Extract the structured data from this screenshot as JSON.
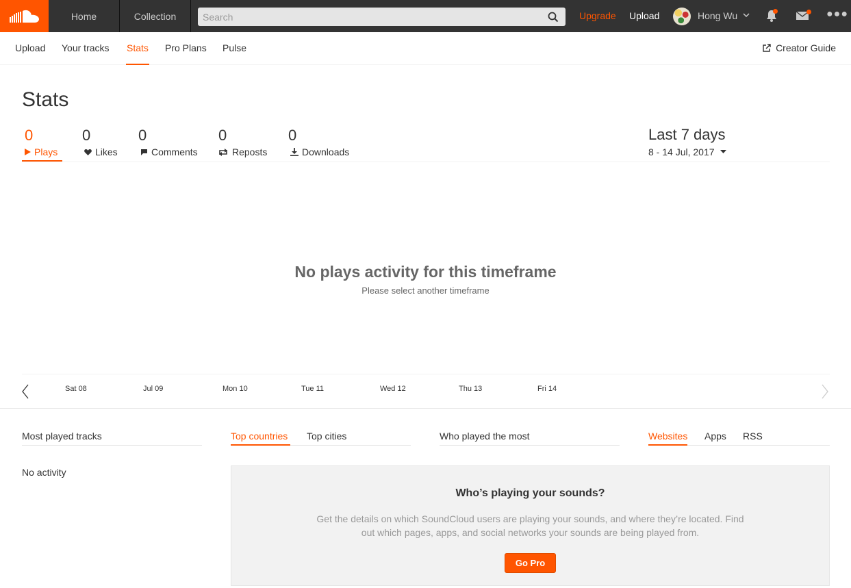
{
  "header": {
    "home_label": "Home",
    "collection_label": "Collection",
    "search_placeholder": "Search",
    "upgrade_label": "Upgrade",
    "upload_label": "Upload",
    "username": "Hong Wu",
    "brand_color": "#ff5500"
  },
  "subnav": {
    "items": [
      {
        "label": "Upload"
      },
      {
        "label": "Your tracks"
      },
      {
        "label": "Stats"
      },
      {
        "label": "Pro Plans"
      },
      {
        "label": "Pulse"
      }
    ],
    "active": "Stats",
    "creator_guide": "Creator Guide"
  },
  "page": {
    "title": "Stats"
  },
  "stats": [
    {
      "value": "0",
      "label": "Plays",
      "icon": "play-icon"
    },
    {
      "value": "0",
      "label": "Likes",
      "icon": "heart-icon"
    },
    {
      "value": "0",
      "label": "Comments",
      "icon": "comment-icon"
    },
    {
      "value": "0",
      "label": "Reposts",
      "icon": "repost-icon"
    },
    {
      "value": "0",
      "label": "Downloads",
      "icon": "download-icon"
    }
  ],
  "range": {
    "title": "Last 7 days",
    "dates": "8 - 14 Jul, 2017"
  },
  "empty_state": {
    "heading": "No plays activity for this timeframe",
    "subtext": "Please select another timeframe"
  },
  "timeline": {
    "ticks": [
      "Sat 08",
      "Jul 09",
      "Mon 10",
      "Tue 11",
      "Wed 12",
      "Thu 13",
      "Fri 14"
    ]
  },
  "sections": {
    "most_played": "Most played tracks",
    "no_activity": "No activity",
    "top_countries": "Top countries",
    "top_cities": "Top cities",
    "who_played": "Who played the most",
    "websites": "Websites",
    "apps": "Apps",
    "rss": "RSS"
  },
  "promo": {
    "heading": "Who’s playing your sounds?",
    "body": "Get the details on which SoundCloud users are playing your sounds, and where they’re located. Find out which pages, apps, and social networks your sounds are being played from.",
    "button": "Go Pro"
  }
}
